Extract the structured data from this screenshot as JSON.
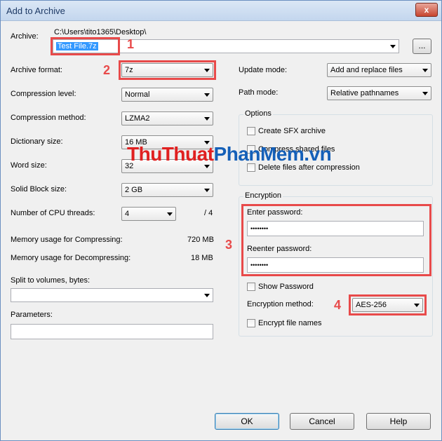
{
  "window": {
    "title": "Add to Archive",
    "close_label": "x"
  },
  "archive": {
    "label": "Archive:",
    "path": "C:\\Users\\tito1365\\Desktop\\",
    "filename": "Test File.7z",
    "browse_label": "..."
  },
  "left": {
    "archive_format": {
      "label": "Archive format:",
      "value": "7z"
    },
    "compression_level": {
      "label": "Compression level:",
      "value": "Normal"
    },
    "compression_method": {
      "label": "Compression method:",
      "value": "LZMA2"
    },
    "dictionary_size": {
      "label": "Dictionary size:",
      "value": "16 MB"
    },
    "word_size": {
      "label": "Word size:",
      "value": "32"
    },
    "solid_block_size": {
      "label": "Solid Block size:",
      "value": "2 GB"
    },
    "cpu_threads": {
      "label": "Number of CPU threads:",
      "value": "4",
      "total": "/ 4"
    },
    "memory_compress": {
      "label": "Memory usage for Compressing:",
      "value": "720 MB"
    },
    "memory_decompress": {
      "label": "Memory usage for Decompressing:",
      "value": "18 MB"
    },
    "split": {
      "label": "Split to volumes, bytes:",
      "value": ""
    },
    "parameters": {
      "label": "Parameters:",
      "value": ""
    }
  },
  "right": {
    "update_mode": {
      "label": "Update mode:",
      "value": "Add and replace files"
    },
    "path_mode": {
      "label": "Path mode:",
      "value": "Relative pathnames"
    },
    "options": {
      "title": "Options",
      "sfx": "Create SFX archive",
      "shared": "Compress shared files",
      "delete": "Delete files after compression"
    },
    "encryption": {
      "title": "Encryption",
      "enter_label": "Enter password:",
      "enter_value": "••••••••",
      "reenter_label": "Reenter password:",
      "reenter_value": "••••••••",
      "show_password": "Show Password",
      "method_label": "Encryption method:",
      "method_value": "AES-256",
      "encrypt_names": "Encrypt file names"
    }
  },
  "buttons": {
    "ok": "OK",
    "cancel": "Cancel",
    "help": "Help"
  },
  "annotations": {
    "n1": "1",
    "n2": "2",
    "n3": "3",
    "n4": "4",
    "highlight_color": "#e84a4a"
  },
  "watermark": {
    "part1": "ThuThuat",
    "part2": "PhanMem",
    "part3": ".vn"
  }
}
